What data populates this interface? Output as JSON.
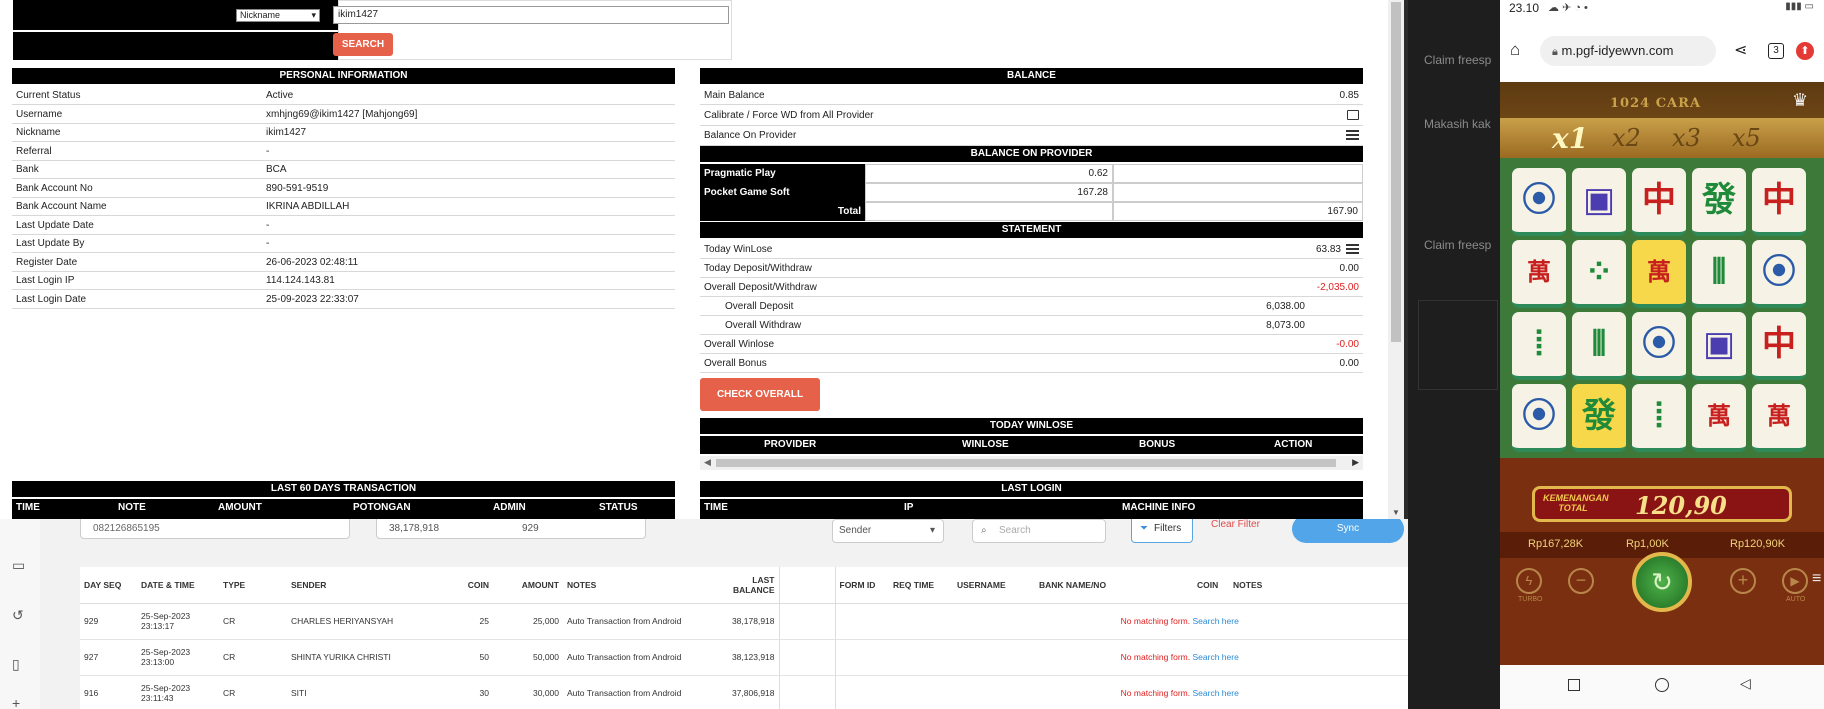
{
  "search": {
    "field_option": "Nickname",
    "value": "ikim1427",
    "button": "SEARCH"
  },
  "personal": {
    "title": "PERSONAL INFORMATION",
    "rows": [
      {
        "k": "Current Status",
        "v": "Active"
      },
      {
        "k": "Username",
        "v": "xmhjng69@ikim1427  [Mahjong69]"
      },
      {
        "k": "Nickname",
        "v": "ikim1427"
      },
      {
        "k": "Referral",
        "v": "-"
      },
      {
        "k": "Bank",
        "v": "BCA"
      },
      {
        "k": "Bank Account No",
        "v": "890-591-9519"
      },
      {
        "k": "Bank Account Name",
        "v": "IKRINA ABDILLAH"
      },
      {
        "k": "Last Update Date",
        "v": "-"
      },
      {
        "k": "Last Update By",
        "v": "-"
      },
      {
        "k": "Register Date",
        "v": "26-06-2023 02:48:11"
      },
      {
        "k": "Last Login IP",
        "v": "114.124.143.81"
      },
      {
        "k": "Last Login Date",
        "v": "25-09-2023 22:33:07"
      }
    ]
  },
  "balance": {
    "title": "BALANCE",
    "main_label": "Main Balance",
    "main_value": "0.85",
    "calibrate_label": "Calibrate / Force WD from All Provider",
    "on_provider_label": "Balance On Provider"
  },
  "provider": {
    "title": "BALANCE ON PROVIDER",
    "rows": [
      {
        "name": "Pragmatic Play",
        "value": "0.62"
      },
      {
        "name": "Pocket Game Soft",
        "value": "167.28"
      }
    ],
    "total_label": "Total",
    "total_value": "167.90"
  },
  "statement": {
    "title": "STATEMENT",
    "today_winlose": "Today WinLose",
    "today_winlose_v": "63.83",
    "today_dw": "Today Deposit/Withdraw",
    "today_dw_v": "0.00",
    "overall_dw": "Overall Deposit/Withdraw",
    "overall_dw_v": "-2,035.00",
    "overall_dep": "Overall Deposit",
    "overall_dep_v": "6,038.00",
    "overall_wd": "Overall Withdraw",
    "overall_wd_v": "8,073.00",
    "overall_wl": "Overall Winlose",
    "overall_wl_v": "-0.00",
    "overall_bonus": "Overall Bonus",
    "overall_bonus_v": "0.00",
    "check_button": "CHECK OVERALL"
  },
  "today_winlose": {
    "title": "TODAY WINLOSE",
    "cols": [
      "PROVIDER",
      "WINLOSE",
      "BONUS",
      "ACTION"
    ]
  },
  "last60": {
    "title": "LAST 60 DAYS TRANSACTION",
    "cols": [
      "TIME",
      "NOTE",
      "AMOUNT",
      "POTONGAN",
      "ADMIN",
      "STATUS"
    ]
  },
  "last_login": {
    "title": "LAST LOGIN",
    "cols": [
      "TIME",
      "IP",
      "MACHINE INFO"
    ]
  },
  "bank_list": {
    "phone": "082126865195",
    "total": "38,178,918",
    "count": "929",
    "sender_select": "Sender",
    "search_placeholder": "Search",
    "filters": "Filters",
    "clear_filter": "Clear Filter",
    "sync": "Sync",
    "headers": [
      "DAY SEQ",
      "DATE & TIME",
      "TYPE",
      "SENDER",
      "COIN",
      "AMOUNT",
      "NOTES",
      "LAST BALANCE",
      "",
      "FORM ID",
      "REQ TIME",
      "USERNAME",
      "BANK NAME/NO",
      "COIN",
      "NOTES"
    ],
    "rows": [
      {
        "seq": "929",
        "date": "25-Sep-2023",
        "time": "23:13:17",
        "type": "CR",
        "sender": "CHARLES HERIYANSYAH",
        "coin": "25",
        "amount": "25,000",
        "notes": "Auto Transaction from Android",
        "last": "38,178,918"
      },
      {
        "seq": "927",
        "date": "25-Sep-2023",
        "time": "23:13:00",
        "type": "CR",
        "sender": "SHINTA YURIKA CHRISTI",
        "coin": "50",
        "amount": "50,000",
        "notes": "Auto Transaction from Android",
        "last": "38,123,918"
      },
      {
        "seq": "916",
        "date": "25-Sep-2023",
        "time": "23:11:43",
        "type": "CR",
        "sender": "SITI",
        "coin": "30",
        "amount": "30,000",
        "notes": "Auto Transaction from Android",
        "last": "37,806,918"
      }
    ],
    "no_match": "No matching form.",
    "search_here": "Search here"
  },
  "bg_window": {
    "lines": [
      "Claim freesp",
      "Makasih kak",
      "Claim freesp"
    ]
  },
  "phone": {
    "time": "23.10",
    "url": "m.pgf-idyewvn.com",
    "tab_count": "3",
    "title_text": "1024 CARA",
    "multipliers": [
      "x1",
      "x2",
      "x3",
      "x5"
    ],
    "win_label": "KEMENANGAN TOTAL",
    "win_value": "120,90",
    "balance": "Rp167,28K",
    "bet": "Rp1,00K",
    "win": "Rp120,90K",
    "turbo": "TURBO",
    "auto": "AUTO",
    "colors": {
      "felt": "#7a3010",
      "gold": "#f2c94c",
      "green": "#2f8a5a"
    }
  }
}
